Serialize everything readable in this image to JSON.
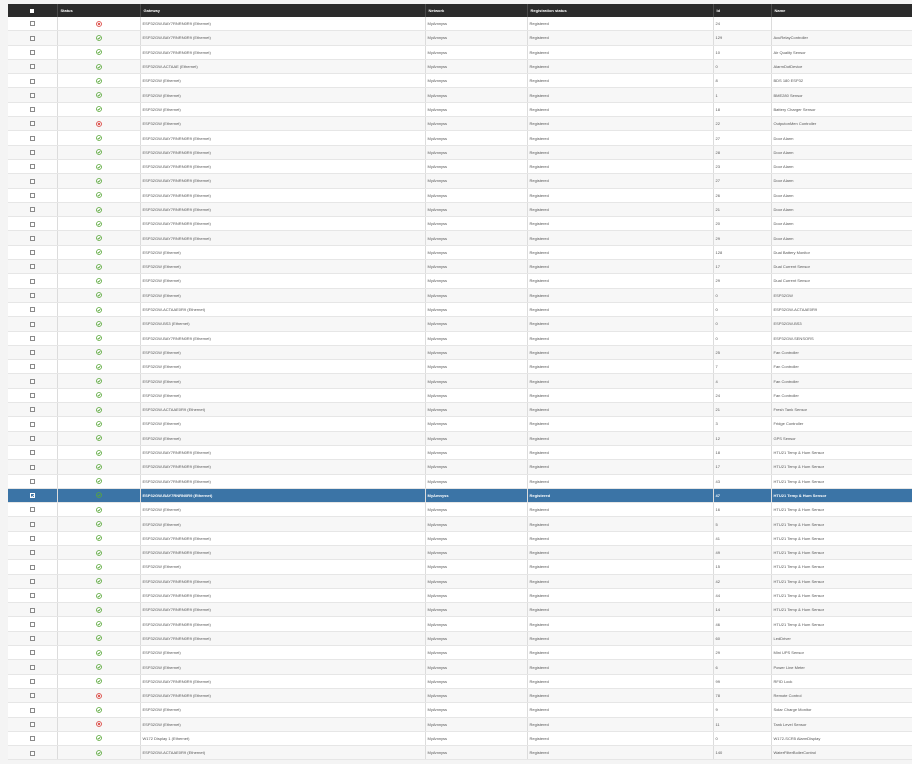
{
  "columns": [
    "",
    "Status",
    "Gateway",
    "Network",
    "Registration status",
    "Id",
    "Name"
  ],
  "colors": {
    "header_bg": "#2b2b2b",
    "selected_row": "#3b74a6",
    "ok": "#5aa83a",
    "error": "#d9403a"
  },
  "rows": [
    {
      "status": "error",
      "gateway": "ESP32GW-BAY7RNRN0R9 (Ethernet)",
      "network": "MyAmnyss",
      "reg": "Registered",
      "id": "24",
      "name": ""
    },
    {
      "status": "ok",
      "gateway": "ESP32GW-BAY7RNRN0R9 (Ethernet)",
      "network": "MyAmnyss",
      "reg": "Registered",
      "id": "129",
      "name": "AcuRelayController"
    },
    {
      "status": "ok",
      "gateway": "ESP32GW-BAY7RNRN0R9 (Ethernet)",
      "network": "MyAmnyss",
      "reg": "Registered",
      "id": "10",
      "name": "Air Quality Sensor"
    },
    {
      "status": "ok",
      "gateway": "ESP32GW-ACTAAE (Ethernet)",
      "network": "MyAmnyss",
      "reg": "Registered",
      "id": "0",
      "name": "AlarmDotDevice"
    },
    {
      "status": "ok",
      "gateway": "ESP32GW (Ethernet)",
      "network": "MyAmnyss",
      "reg": "Registered",
      "id": "8",
      "name": "BDS 180 ESP32"
    },
    {
      "status": "ok",
      "gateway": "ESP32GW (Ethernet)",
      "network": "MyAmnyss",
      "reg": "Registered",
      "id": "1",
      "name": "BME280 Sensor"
    },
    {
      "status": "ok",
      "gateway": "ESP32GW (Ethernet)",
      "network": "MyAmnyss",
      "reg": "Registered",
      "id": "18",
      "name": "Battery Charger Sensor"
    },
    {
      "status": "error",
      "gateway": "ESP32GW (Ethernet)",
      "network": "MyAmnyss",
      "reg": "Registered",
      "id": "22",
      "name": "OutputonMen Controller"
    },
    {
      "status": "ok",
      "gateway": "ESP32GW-BAY7RNRN0R9 (Ethernet)",
      "network": "MyAmnyss",
      "reg": "Registered",
      "id": "27",
      "name": "Door Alarm"
    },
    {
      "status": "ok",
      "gateway": "ESP32GW-BAY7RNRN0R9 (Ethernet)",
      "network": "MyAmnyss",
      "reg": "Registered",
      "id": "28",
      "name": "Door Alarm"
    },
    {
      "status": "ok",
      "gateway": "ESP32GW-BAY7RNRN0R9 (Ethernet)",
      "network": "MyAmnyss",
      "reg": "Registered",
      "id": "23",
      "name": "Door Alarm"
    },
    {
      "status": "ok",
      "gateway": "ESP32GW-BAY7RNRN0R9 (Ethernet)",
      "network": "MyAmnyss",
      "reg": "Registered",
      "id": "27",
      "name": "Door Alarm"
    },
    {
      "status": "ok",
      "gateway": "ESP32GW-BAY7RNRN0R9 (Ethernet)",
      "network": "MyAmnyss",
      "reg": "Registered",
      "id": "26",
      "name": "Door Alarm"
    },
    {
      "status": "ok",
      "gateway": "ESP32GW-BAY7RNRN0R9 (Ethernet)",
      "network": "MyAmnyss",
      "reg": "Registered",
      "id": "21",
      "name": "Door Alarm"
    },
    {
      "status": "ok",
      "gateway": "ESP32GW-BAY7RNRN0R9 (Ethernet)",
      "network": "MyAmnyss",
      "reg": "Registered",
      "id": "20",
      "name": "Door Alarm"
    },
    {
      "status": "ok",
      "gateway": "ESP32GW-BAY7RNRN0R9 (Ethernet)",
      "network": "MyAmnyss",
      "reg": "Registered",
      "id": "29",
      "name": "Door Alarm"
    },
    {
      "status": "ok",
      "gateway": "ESP32GW (Ethernet)",
      "network": "MyAmnyss",
      "reg": "Registered",
      "id": "128",
      "name": "Dual Battery Monitor"
    },
    {
      "status": "ok",
      "gateway": "ESP32GW (Ethernet)",
      "network": "MyAmnyss",
      "reg": "Registered",
      "id": "17",
      "name": "Dual Current Sensor"
    },
    {
      "status": "ok",
      "gateway": "ESP32GW (Ethernet)",
      "network": "MyAmnyss",
      "reg": "Registered",
      "id": "29",
      "name": "Dual Current Sensor"
    },
    {
      "status": "ok",
      "gateway": "ESP32GW (Ethernet)",
      "network": "MyAmnyss",
      "reg": "Registered",
      "id": "0",
      "name": "ESP32GW"
    },
    {
      "status": "ok",
      "gateway": "ESP32GW-ACTAAE0R9 (Ethernet)",
      "network": "MyAmnyss",
      "reg": "Registered",
      "id": "0",
      "name": "ESP32GW-ACTAAE0R9"
    },
    {
      "status": "ok",
      "gateway": "ESP32GW-BS3 (Ethernet)",
      "network": "MyAmnyss",
      "reg": "Registered",
      "id": "0",
      "name": "ESP32GW-BS3"
    },
    {
      "status": "ok",
      "gateway": "ESP32GW-BAY7RNRN0R9 (Ethernet)",
      "network": "MyAmnyss",
      "reg": "Registered",
      "id": "0",
      "name": "ESP32GW-SENSORS"
    },
    {
      "status": "ok",
      "gateway": "ESP32GW (Ethernet)",
      "network": "MyAmnyss",
      "reg": "Registered",
      "id": "25",
      "name": "Fan Controller"
    },
    {
      "status": "ok",
      "gateway": "ESP32GW (Ethernet)",
      "network": "MyAmnyss",
      "reg": "Registered",
      "id": "7",
      "name": "Fan Controller"
    },
    {
      "status": "ok",
      "gateway": "ESP32GW (Ethernet)",
      "network": "MyAmnyss",
      "reg": "Registered",
      "id": "4",
      "name": "Fan Controller"
    },
    {
      "status": "ok",
      "gateway": "ESP32GW (Ethernet)",
      "network": "MyAmnyss",
      "reg": "Registered",
      "id": "24",
      "name": "Fan Controller"
    },
    {
      "status": "ok",
      "gateway": "ESP32GW-ACTAAE0R9 (Ethernet)",
      "network": "MyAmnyss",
      "reg": "Registered",
      "id": "21",
      "name": "Fresh Tank Sensor"
    },
    {
      "status": "ok",
      "gateway": "ESP32GW (Ethernet)",
      "network": "MyAmnyss",
      "reg": "Registered",
      "id": "3",
      "name": "Fridge Controller"
    },
    {
      "status": "ok",
      "gateway": "ESP32GW (Ethernet)",
      "network": "MyAmnyss",
      "reg": "Registered",
      "id": "12",
      "name": "GPS Sensor"
    },
    {
      "status": "ok",
      "gateway": "ESP32GW-BAY7RNRN0R9 (Ethernet)",
      "network": "MyAmnyss",
      "reg": "Registered",
      "id": "18",
      "name": "HTU21 Temp & Hum Sensor"
    },
    {
      "status": "ok",
      "gateway": "ESP32GW-BAY7RNRN0R9 (Ethernet)",
      "network": "MyAmnyss",
      "reg": "Registered",
      "id": "17",
      "name": "HTU21 Temp & Hum Sensor"
    },
    {
      "status": "ok",
      "gateway": "ESP32GW-BAY7RNRN0R9 (Ethernet)",
      "network": "MyAmnyss",
      "reg": "Registered",
      "id": "43",
      "name": "HTU21 Temp & Hum Sensor"
    },
    {
      "status": "ok",
      "gateway": "ESP32GW-BAY7RNRN0R9 (Ethernet)",
      "network": "MyAmnyss",
      "reg": "Registered",
      "id": "47",
      "name": "HTU21 Temp & Hum Sensor",
      "selected": true
    },
    {
      "status": "ok",
      "gateway": "ESP32GW (Ethernet)",
      "network": "MyAmnyss",
      "reg": "Registered",
      "id": "16",
      "name": "HTU21 Temp & Hum Sensor"
    },
    {
      "status": "ok",
      "gateway": "ESP32GW (Ethernet)",
      "network": "MyAmnyss",
      "reg": "Registered",
      "id": "5",
      "name": "HTU21 Temp & Hum Sensor"
    },
    {
      "status": "ok",
      "gateway": "ESP32GW-BAY7RNRN0R9 (Ethernet)",
      "network": "MyAmnyss",
      "reg": "Registered",
      "id": "41",
      "name": "HTU21 Temp & Hum Sensor"
    },
    {
      "status": "ok",
      "gateway": "ESP32GW-BAY7RNRN0R9 (Ethernet)",
      "network": "MyAmnyss",
      "reg": "Registered",
      "id": "49",
      "name": "HTU21 Temp & Hum Sensor"
    },
    {
      "status": "ok",
      "gateway": "ESP32GW (Ethernet)",
      "network": "MyAmnyss",
      "reg": "Registered",
      "id": "15",
      "name": "HTU21 Temp & Hum Sensor"
    },
    {
      "status": "ok",
      "gateway": "ESP32GW-BAY7RNRN0R9 (Ethernet)",
      "network": "MyAmnyss",
      "reg": "Registered",
      "id": "42",
      "name": "HTU21 Temp & Hum Sensor"
    },
    {
      "status": "ok",
      "gateway": "ESP32GW-BAY7RNRN0R9 (Ethernet)",
      "network": "MyAmnyss",
      "reg": "Registered",
      "id": "44",
      "name": "HTU21 Temp & Hum Sensor"
    },
    {
      "status": "ok",
      "gateway": "ESP32GW-BAY7RNRN0R9 (Ethernet)",
      "network": "MyAmnyss",
      "reg": "Registered",
      "id": "14",
      "name": "HTU21 Temp & Hum Sensor"
    },
    {
      "status": "ok",
      "gateway": "ESP32GW-BAY7RNRN0R9 (Ethernet)",
      "network": "MyAmnyss",
      "reg": "Registered",
      "id": "46",
      "name": "HTU21 Temp & Hum Sensor"
    },
    {
      "status": "ok",
      "gateway": "ESP32GW-BAY7RNRN0R9 (Ethernet)",
      "network": "MyAmnyss",
      "reg": "Registered",
      "id": "60",
      "name": "LedDriver"
    },
    {
      "status": "ok",
      "gateway": "ESP32GW (Ethernet)",
      "network": "MyAmnyss",
      "reg": "Registered",
      "id": "29",
      "name": "Mini UPS Sensor"
    },
    {
      "status": "ok",
      "gateway": "ESP32GW (Ethernet)",
      "network": "MyAmnyss",
      "reg": "Registered",
      "id": "6",
      "name": "Power Line Meter"
    },
    {
      "status": "ok",
      "gateway": "ESP32GW-BAY7RNRN0R9 (Ethernet)",
      "network": "MyAmnyss",
      "reg": "Registered",
      "id": "99",
      "name": "RFID Lock"
    },
    {
      "status": "error",
      "gateway": "ESP32GW-BAY7RNRN0R9 (Ethernet)",
      "network": "MyAmnyss",
      "reg": "Registered",
      "id": "78",
      "name": "Remote Control"
    },
    {
      "status": "ok",
      "gateway": "ESP32GW (Ethernet)",
      "network": "MyAmnyss",
      "reg": "Registered",
      "id": "9",
      "name": "Solar Charge Monitor"
    },
    {
      "status": "error",
      "gateway": "ESP32GW (Ethernet)",
      "network": "MyAmnyss",
      "reg": "Registered",
      "id": "11",
      "name": "Tank Level Sensor"
    },
    {
      "status": "ok",
      "gateway": "W172 Display 1 (Ethernet)",
      "network": "MyAmnyss",
      "reg": "Registered",
      "id": "0",
      "name": "W172-SCR5 AlarmDisplay"
    },
    {
      "status": "ok",
      "gateway": "ESP32GW-ACTAAE0R9 (Ethernet)",
      "network": "MyAmnyss",
      "reg": "Registered",
      "id": "140",
      "name": "WaterFilterBoilerControl"
    }
  ]
}
